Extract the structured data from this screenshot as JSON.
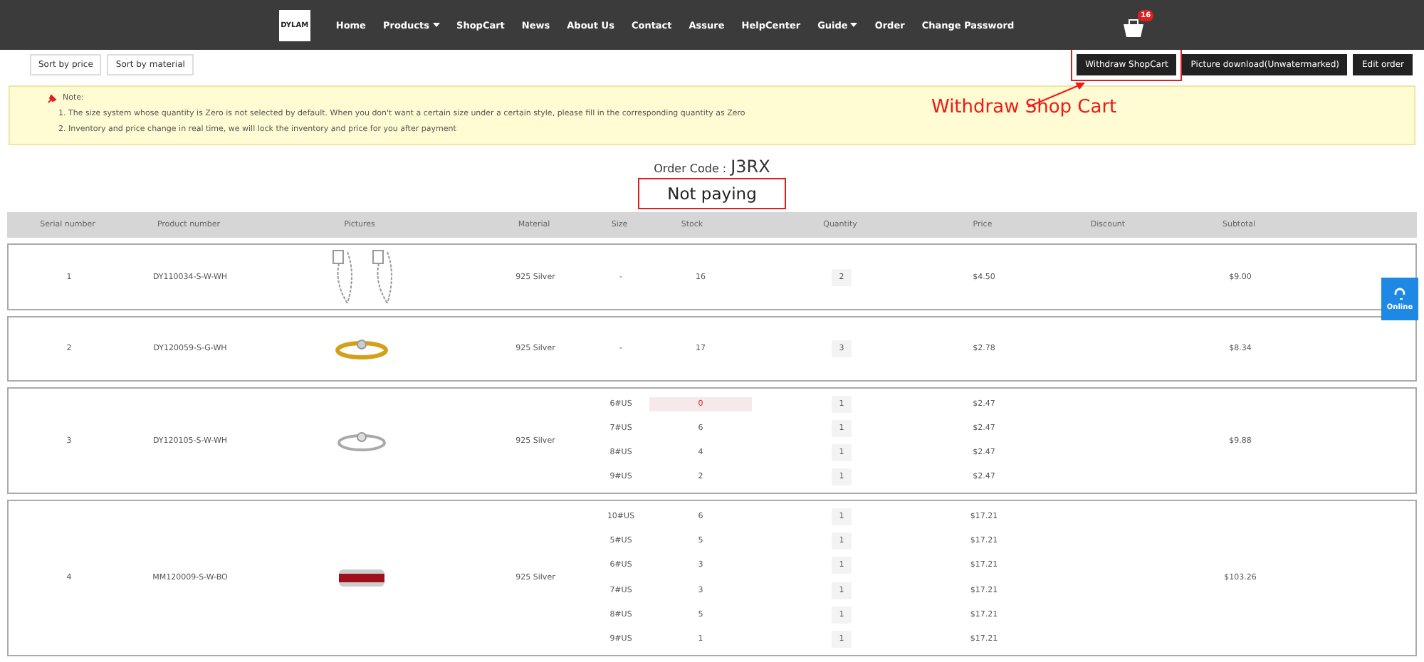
{
  "nav": {
    "logo": "DYLAM",
    "items": [
      {
        "label": "Home",
        "dropdown": false
      },
      {
        "label": "Products",
        "dropdown": true
      },
      {
        "label": "ShopCart",
        "dropdown": false
      },
      {
        "label": "News",
        "dropdown": false
      },
      {
        "label": "About Us",
        "dropdown": false
      },
      {
        "label": "Contact",
        "dropdown": false
      },
      {
        "label": "Assure",
        "dropdown": false
      },
      {
        "label": "HelpCenter",
        "dropdown": false
      },
      {
        "label": "Guide",
        "dropdown": true
      },
      {
        "label": "Order",
        "dropdown": false
      },
      {
        "label": "Change Password",
        "dropdown": false
      }
    ],
    "cart_count": "16"
  },
  "sort_buttons": [
    "Sort by price",
    "Sort by material"
  ],
  "action_buttons": [
    {
      "label": "Withdraw ShopCart",
      "highlighted": true
    },
    {
      "label": "Picture download(Unwatermarked)",
      "highlighted": false
    },
    {
      "label": "Edit order",
      "highlighted": false
    }
  ],
  "annotation": "Withdraw Shop Cart",
  "note": {
    "title": "Note:",
    "lines": [
      "1. The size system whose quantity is Zero is not selected by default. When you don't want a certain size under a certain style, please fill in the corresponding quantity as Zero",
      "2. Inventory and price change in real time, we will lock the inventory and price for you after payment"
    ]
  },
  "order_code": {
    "label": "Order Code :",
    "value": "J3RX"
  },
  "status": "Not paying",
  "table": {
    "columns": [
      "Serial number",
      "Product number",
      "Pictures",
      "Material",
      "Size",
      "Stock",
      "Quantity",
      "Price",
      "Discount",
      "Subtotal"
    ],
    "rows": [
      {
        "serial": "1",
        "product": "DY110034-S-W-WH",
        "kind": "earrings",
        "material": "925 Silver",
        "subtotal": "$9.00",
        "variants": [
          {
            "size": "-",
            "stock": "16",
            "quantity": "2",
            "price": "$4.50",
            "warning": false
          }
        ]
      },
      {
        "serial": "2",
        "product": "DY120059-S-G-WH",
        "kind": "gold-ring",
        "material": "925 Silver",
        "subtotal": "$8.34",
        "variants": [
          {
            "size": "-",
            "stock": "17",
            "quantity": "3",
            "price": "$2.78",
            "warning": false
          }
        ]
      },
      {
        "serial": "3",
        "product": "DY120105-S-W-WH",
        "kind": "silver-ring",
        "material": "925 Silver",
        "subtotal": "$9.88",
        "variants": [
          {
            "size": "6#US",
            "stock": "0",
            "quantity": "1",
            "price": "$2.47",
            "warning": true
          },
          {
            "size": "7#US",
            "stock": "6",
            "quantity": "1",
            "price": "$2.47",
            "warning": false
          },
          {
            "size": "8#US",
            "stock": "4",
            "quantity": "1",
            "price": "$2.47",
            "warning": false
          },
          {
            "size": "9#US",
            "stock": "2",
            "quantity": "1",
            "price": "$2.47",
            "warning": false
          }
        ]
      },
      {
        "serial": "4",
        "product": "MM120009-S-W-BO",
        "kind": "band-ring",
        "material": "925 Silver",
        "subtotal": "$103.26",
        "variants": [
          {
            "size": "10#US",
            "stock": "6",
            "quantity": "1",
            "price": "$17.21",
            "warning": false
          },
          {
            "size": "5#US",
            "stock": "5",
            "quantity": "1",
            "price": "$17.21",
            "warning": false
          },
          {
            "size": "6#US",
            "stock": "3",
            "quantity": "1",
            "price": "$17.21",
            "warning": false
          },
          {
            "size": "7#US",
            "stock": "3",
            "quantity": "1",
            "price": "$17.21",
            "warning": false
          },
          {
            "size": "8#US",
            "stock": "5",
            "quantity": "1",
            "price": "$17.21",
            "warning": false
          },
          {
            "size": "9#US",
            "stock": "1",
            "quantity": "1",
            "price": "$17.21",
            "warning": false
          }
        ]
      }
    ]
  },
  "chat_widget": "Online"
}
